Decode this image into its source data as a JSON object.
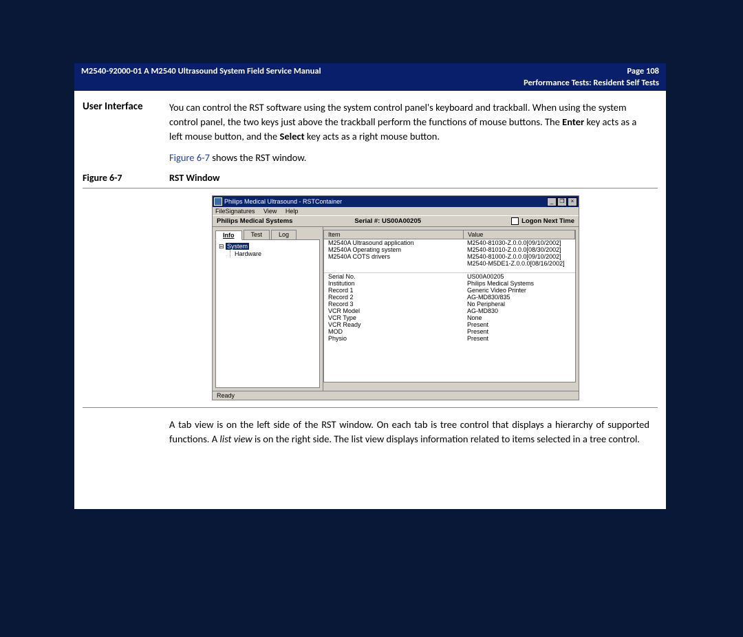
{
  "header": {
    "left": "M2540-92000-01 A M2540 Ultrasound System Field Service Manual",
    "right": "Page 108",
    "sub": "Performance Tests: Resident Self Tests"
  },
  "section_title": "User Interface",
  "para1_a": "You can control the RST software using the system control panel's keyboard and trackball. When using the system control panel, the two keys just above the trackball perform the functions of mouse buttons. The ",
  "para1_b": "Enter",
  "para1_c": " key acts as a left mouse button, and the ",
  "para1_d": "Select",
  "para1_e": " key acts as a right mouse button.",
  "para2_link": "Figure 6-7",
  "para2_rest": " shows the RST window.",
  "fig_label": "Figure 6-7",
  "fig_caption": "RST Window",
  "shot": {
    "title": "Philips Medical Ultrasound - RSTContainer",
    "menu": {
      "a": "FileSignatures",
      "b": "View",
      "c": "Help"
    },
    "info_left": "Philips Medical Systems",
    "info_mid_label": "Serial #: ",
    "info_mid_val": "US00A00205",
    "info_right": "Logon Next Time",
    "tabs": {
      "info": "Info",
      "test": "Test",
      "log": "Log"
    },
    "tree_root": "System",
    "tree_child": "Hardware",
    "hdr_item": "Item",
    "hdr_value": "Value",
    "rows1": [
      {
        "item": "M2540A Ultrasound application",
        "value": "M2540-81030-Z.0.0.0[09/10/2002]"
      },
      {
        "item": "M2540A Operating system",
        "value": "M2540-81010-Z.0.0.0[08/30/2002]"
      },
      {
        "item": "M2540A COTS drivers",
        "value": "M2540-81000-Z.0.0.0[09/10/2002]"
      },
      {
        "item": "",
        "value": "M2540-M5DE1-Z.0.0.0[08/16/2002]"
      }
    ],
    "rows2": [
      {
        "item": "Serial No.",
        "value": "US00A00205"
      },
      {
        "item": "Institution",
        "value": "Philips Medical Systems"
      },
      {
        "item": "Record 1",
        "value": "Generic Video Printer"
      },
      {
        "item": "Record 2",
        "value": "AG-MD830/835"
      },
      {
        "item": "Record 3",
        "value": "No Peripheral"
      },
      {
        "item": "VCR Model",
        "value": "AG-MD830"
      },
      {
        "item": "VCR Type",
        "value": "None"
      },
      {
        "item": "VCR Ready",
        "value": "Present"
      },
      {
        "item": "MOD",
        "value": "Present"
      },
      {
        "item": "Physio",
        "value": "Present"
      }
    ],
    "status": "Ready"
  },
  "para3_a": "A tab view is on the left side of the RST window. On each tab is tree control that displays a hierarchy of supported functions. A ",
  "para3_b": "list view",
  "para3_c": " is on the right side. The list view displays information related to items selected in a tree control."
}
